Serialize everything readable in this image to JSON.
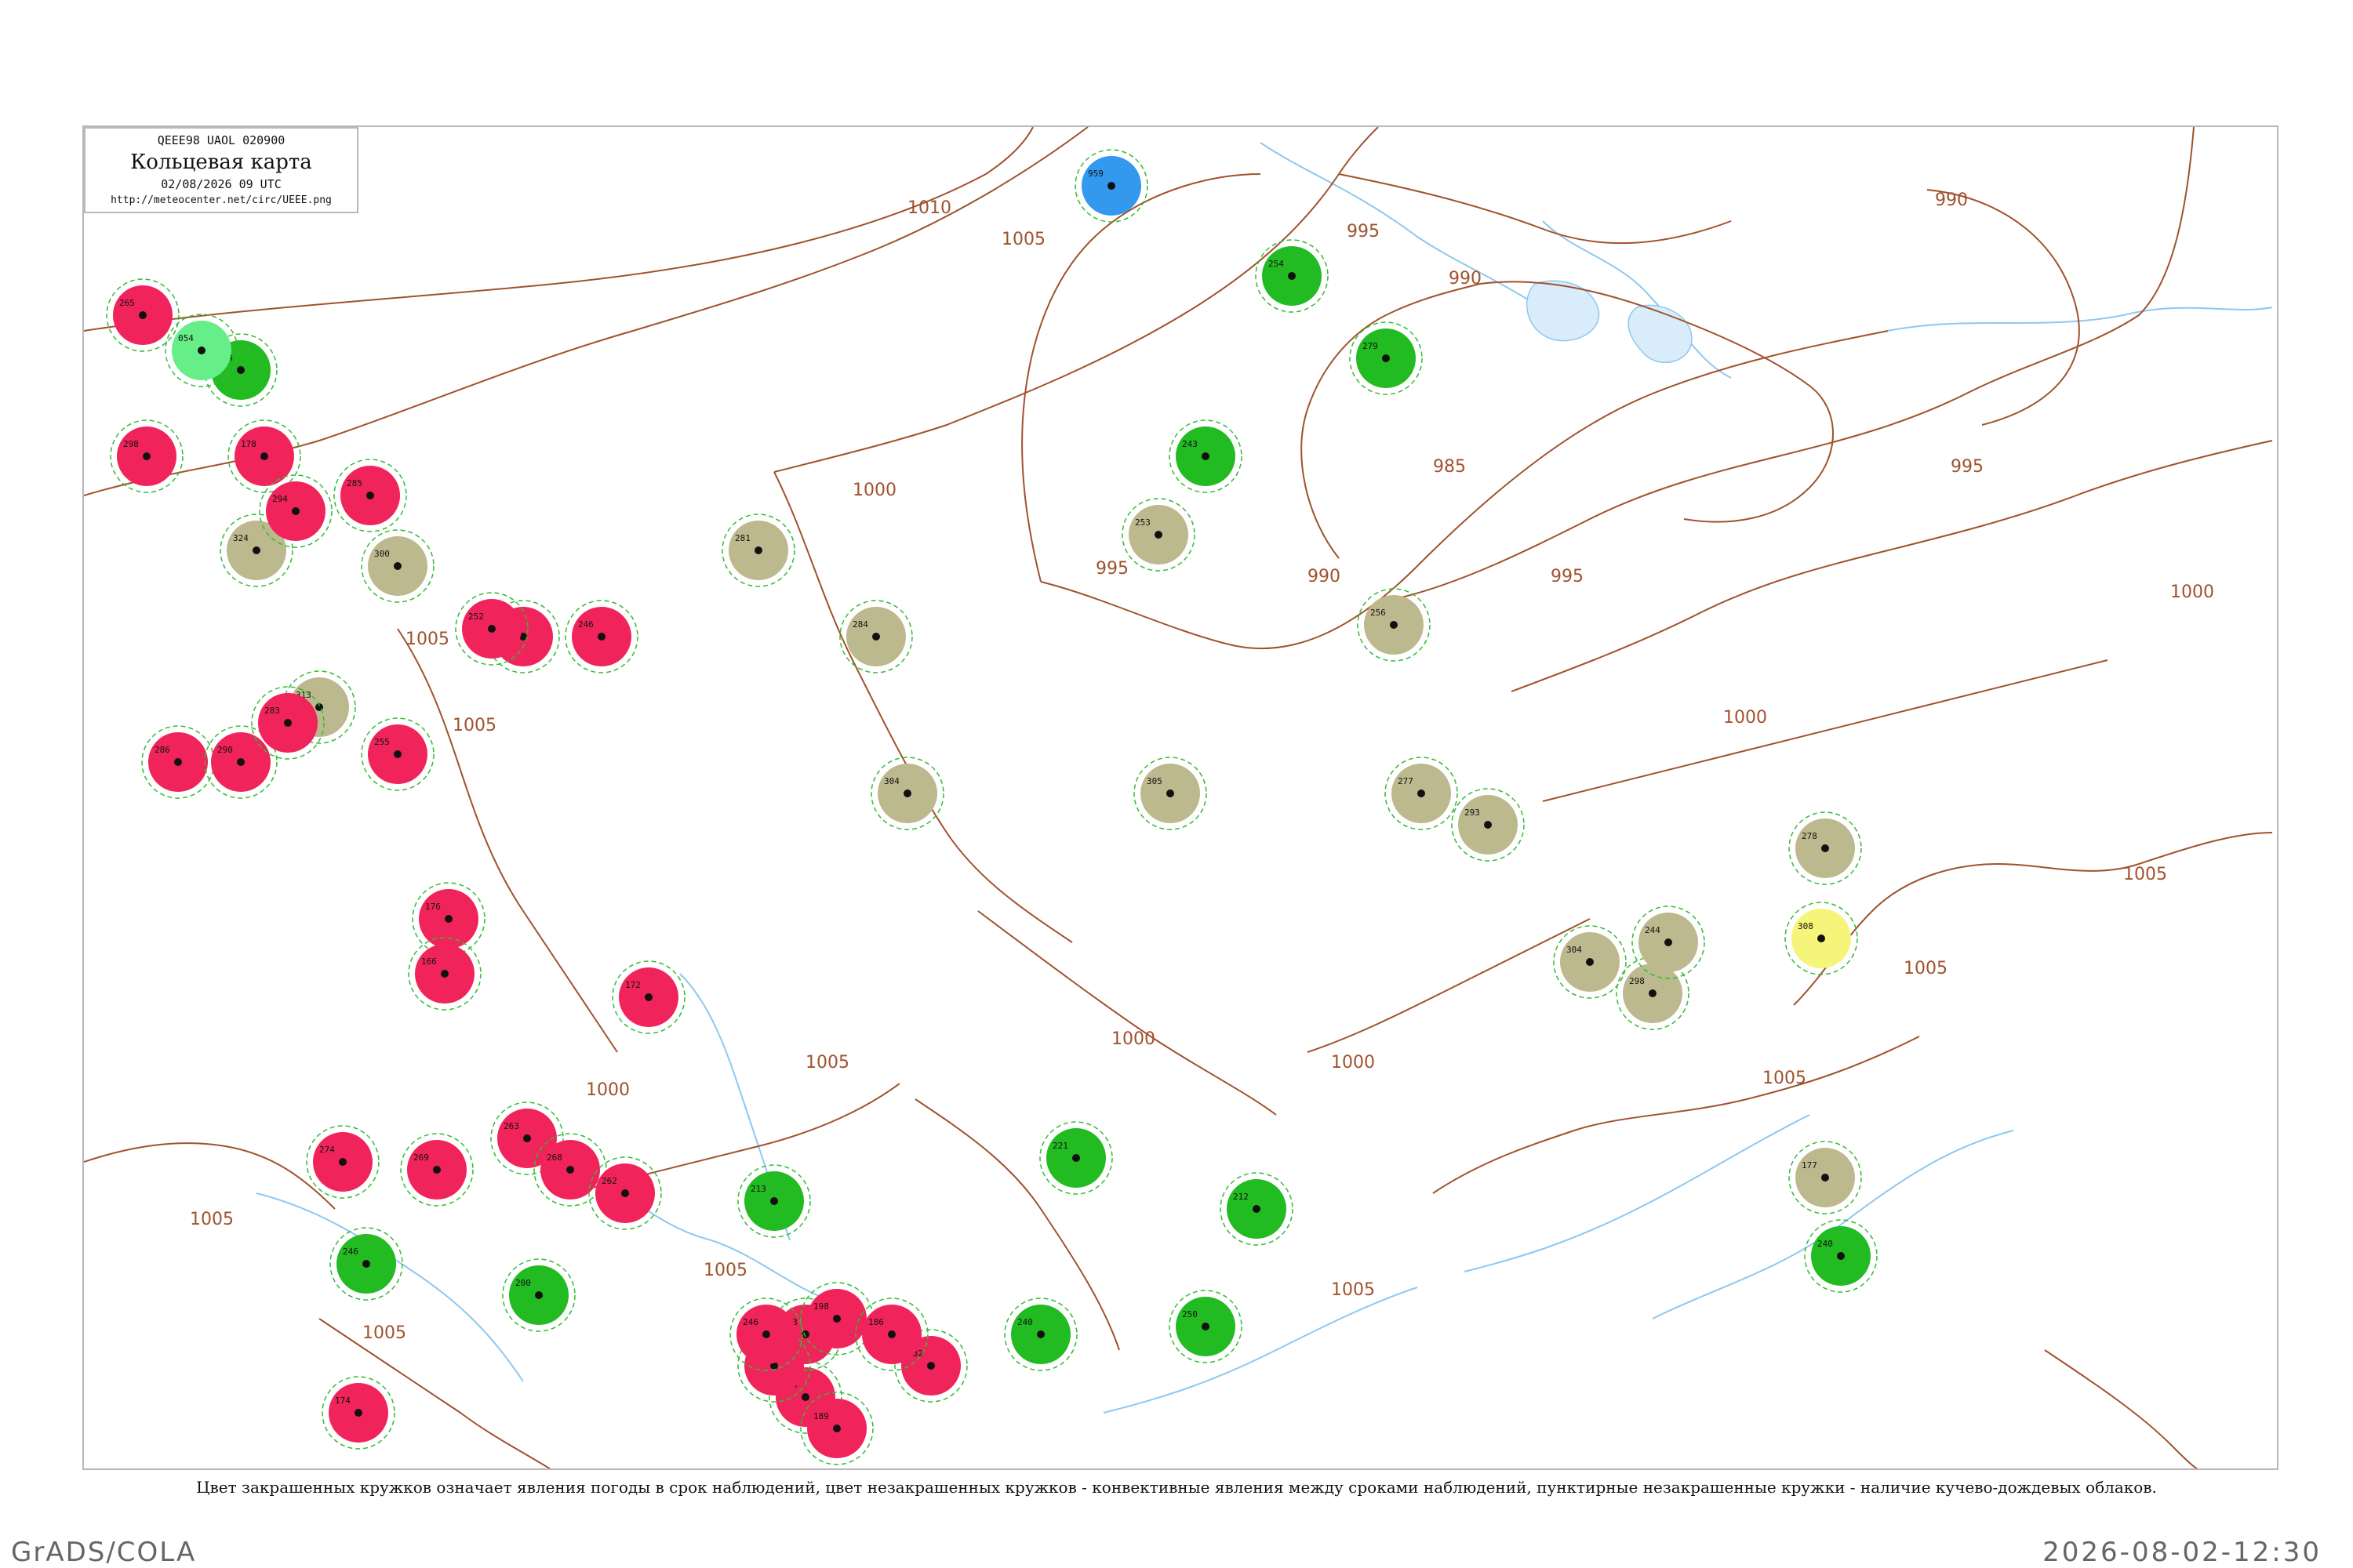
{
  "header": {
    "code": "QEEE98  UAOL  020900",
    "title": "Кольцевая карта",
    "datetime": "02/08/2026 09 UTC",
    "url": "http://meteocenter.net/circ/UEEE.png"
  },
  "caption": "Цвет закрашенных кружков означает явления погоды в срок наблюдений, цвет незакрашенных кружков - конвективные явления между сроками наблюдений, пунктирные незакрашенные кружки - наличие кучево-дождевых облаков.",
  "footer": {
    "left": "GrADS/COLA",
    "right": "2026-08-02-12:30"
  },
  "colors": {
    "rain": "#f0245a",
    "thunder": "#22bb22",
    "fog": "#bdb98e",
    "snow": "#3399ee",
    "drizzle": "#66ee88",
    "haze": "#f5f57a",
    "isobar": "#a0522d",
    "river": "#8ec8f0",
    "cb-ring": "#33bb33"
  },
  "isobar_labels": [
    "1010",
    "1005",
    "1000",
    "995",
    "990",
    "985",
    "990",
    "995",
    "1000",
    "1005",
    "1000",
    "995",
    "990",
    "1000",
    "1005",
    "1005",
    "1005",
    "1000",
    "1005",
    "1000",
    "1005",
    "1005",
    "1010",
    "1005",
    "1005"
  ],
  "stations": [
    {
      "type": "rain",
      "num": "265"
    },
    {
      "type": "rain",
      "num": "298"
    },
    {
      "type": "thunder",
      "num": "094"
    },
    {
      "type": "drizzle",
      "num": "054"
    },
    {
      "type": "rain",
      "num": "178"
    },
    {
      "type": "fog",
      "num": "324"
    },
    {
      "type": "rain",
      "num": "294"
    },
    {
      "type": "rain",
      "num": "285"
    },
    {
      "type": "fog",
      "num": "300"
    },
    {
      "type": "rain",
      "num": "278"
    },
    {
      "type": "rain",
      "num": "246"
    },
    {
      "type": "rain",
      "num": "252"
    },
    {
      "type": "fog",
      "num": "313"
    },
    {
      "type": "rain",
      "num": "286"
    },
    {
      "type": "rain",
      "num": "290"
    },
    {
      "type": "rain",
      "num": "283"
    },
    {
      "type": "rain",
      "num": "255"
    },
    {
      "type": "rain",
      "num": "176"
    },
    {
      "type": "rain",
      "num": "166"
    },
    {
      "type": "rain",
      "num": "274"
    },
    {
      "type": "rain",
      "num": "269"
    },
    {
      "type": "rain",
      "num": "263"
    },
    {
      "type": "rain",
      "num": "268"
    },
    {
      "type": "rain",
      "num": "262"
    },
    {
      "type": "thunder",
      "num": "200"
    },
    {
      "type": "rain",
      "num": "172"
    },
    {
      "type": "rain",
      "num": "244"
    },
    {
      "type": "thunder",
      "num": "213"
    },
    {
      "type": "rain",
      "num": "293"
    },
    {
      "type": "rain",
      "num": "190"
    },
    {
      "type": "rain",
      "num": "198"
    },
    {
      "type": "rain",
      "num": "189"
    },
    {
      "type": "rain",
      "num": "182"
    },
    {
      "type": "rain",
      "num": "186"
    },
    {
      "type": "rain",
      "num": "246"
    },
    {
      "type": "thunder",
      "num": "240"
    },
    {
      "type": "thunder",
      "num": "221"
    },
    {
      "type": "fog",
      "num": "281"
    },
    {
      "type": "fog",
      "num": "284"
    },
    {
      "type": "fog",
      "num": "304"
    },
    {
      "type": "snow",
      "num": "959"
    },
    {
      "type": "thunder",
      "num": "254"
    },
    {
      "type": "thunder",
      "num": "279"
    },
    {
      "type": "thunder",
      "num": "243"
    },
    {
      "type": "fog",
      "num": "253"
    },
    {
      "type": "fog",
      "num": "256"
    },
    {
      "type": "thunder",
      "num": "250"
    },
    {
      "type": "thunder",
      "num": "212"
    },
    {
      "type": "fog",
      "num": "305"
    },
    {
      "type": "fog",
      "num": "277"
    },
    {
      "type": "fog",
      "num": "293"
    },
    {
      "type": "fog",
      "num": "304"
    },
    {
      "type": "fog",
      "num": "298"
    },
    {
      "type": "fog",
      "num": "244"
    },
    {
      "type": "fog",
      "num": "278"
    },
    {
      "type": "haze",
      "num": "308"
    },
    {
      "type": "fog",
      "num": "177"
    },
    {
      "type": "thunder",
      "num": "240"
    },
    {
      "type": "thunder",
      "num": "246"
    },
    {
      "type": "rain",
      "num": "174"
    }
  ]
}
